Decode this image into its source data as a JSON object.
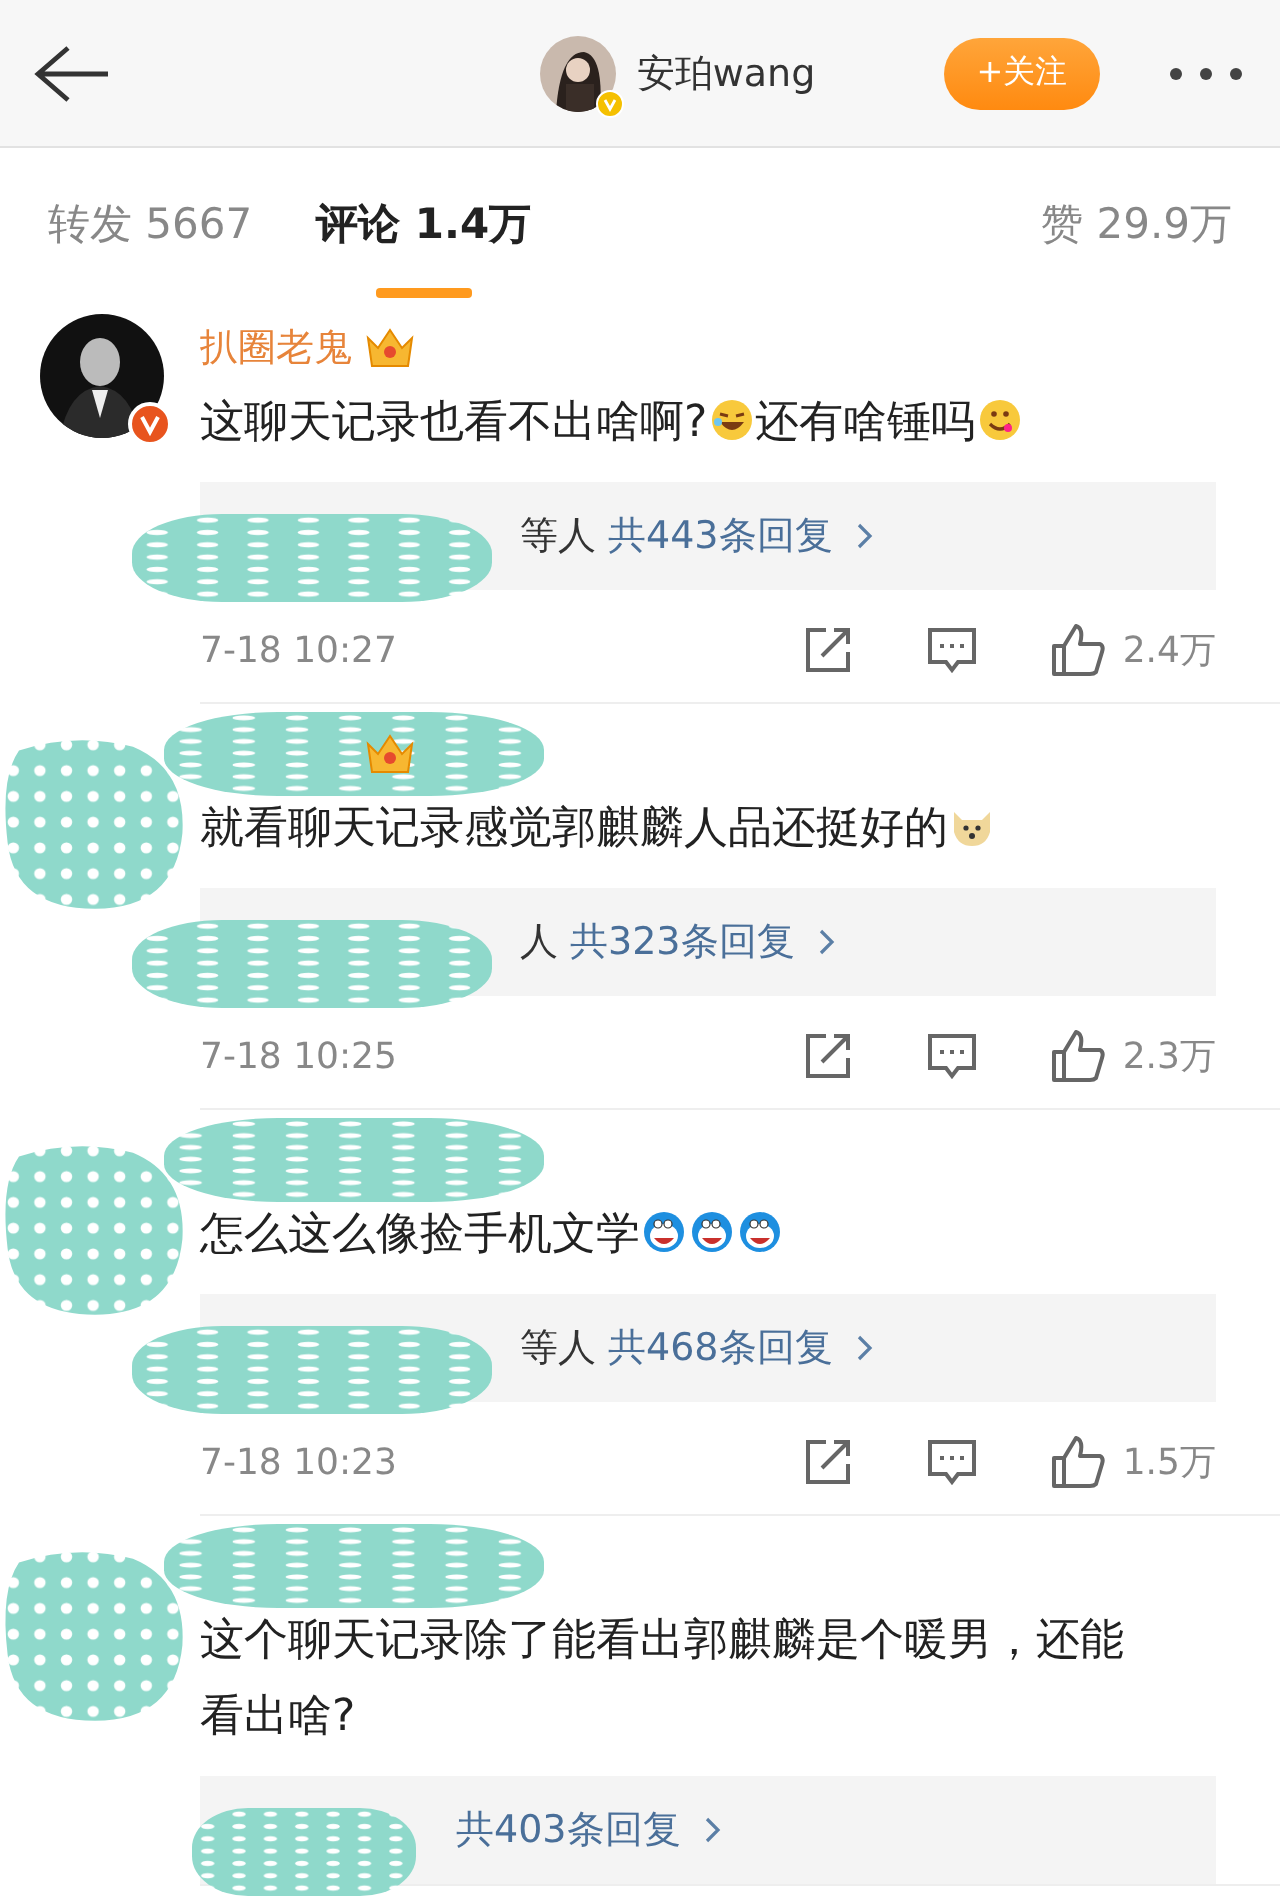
{
  "header": {
    "name": "安珀wang",
    "verified": true,
    "follow_label": "+关注"
  },
  "tabs": [
    {
      "label": "转发",
      "count": "5667",
      "selected": false
    },
    {
      "label": "评论",
      "count": "1.4万",
      "selected": true
    },
    {
      "label": "赞",
      "count": "29.9万",
      "selected": false
    }
  ],
  "comments": [
    {
      "name": "扒圈老鬼",
      "crown": true,
      "verified": true,
      "segments": [
        {
          "kind": "text",
          "text": "这聊天记录也看不出啥啊?"
        },
        {
          "kind": "laugh"
        },
        {
          "kind": "text",
          "text": "还有啥锤吗"
        },
        {
          "kind": "grin"
        }
      ],
      "reply_names": "等人",
      "reply_count": "共443条回复",
      "time": "7-18 10:27",
      "likes": "2.4万",
      "reply_names_hidden": true
    },
    {
      "crown": true,
      "avatar_hidden": true,
      "name_hidden": true,
      "segments": [
        {
          "kind": "text",
          "text": "就看聊天记录感觉郭麒麟人品还挺好的"
        },
        {
          "kind": "doge"
        }
      ],
      "reply_names": "人",
      "reply_count": "共323条回复",
      "time": "7-18 10:25",
      "likes": "2.3万",
      "reply_names_hidden": true
    },
    {
      "avatar_hidden": true,
      "name_hidden": true,
      "segments": [
        {
          "kind": "text",
          "text": "怎么这么像捡手机文学"
        },
        {
          "kind": "blue"
        },
        {
          "kind": "blue"
        },
        {
          "kind": "blue"
        }
      ],
      "reply_names": "等人",
      "reply_count": "共468条回复",
      "time": "7-18 10:23",
      "likes": "1.5万",
      "reply_names_hidden": true
    },
    {
      "avatar_hidden": true,
      "name_hidden": true,
      "segments": [
        {
          "kind": "text",
          "text": "这个聊天记录除了能看出郭麒麟是个暖男，还能看出啥?"
        }
      ],
      "reply_count": "共403条回复",
      "reply_names_hidden": true
    }
  ]
}
